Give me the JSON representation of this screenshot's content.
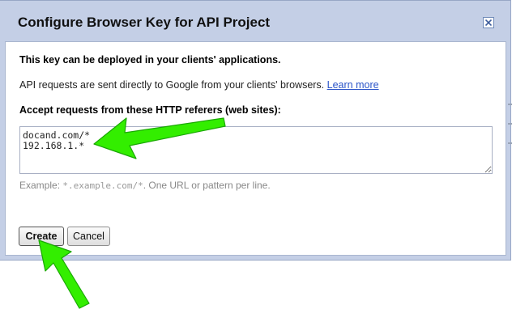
{
  "dialog": {
    "title": "Configure Browser Key for API Project",
    "lead": "This key can be deployed in your clients' applications.",
    "info_text": "API requests are sent directly to Google from your clients' browsers. ",
    "learn_more": "Learn more",
    "field_label": "Accept requests from these HTTP referers (web sites):",
    "referers_value": "docand.com/*\n192.168.1.*",
    "hint_prefix": "Example: ",
    "hint_example": "*.example.com/*",
    "hint_suffix": ". One URL or pattern per line.",
    "create_label": "Create",
    "cancel_label": "Cancel"
  },
  "icons": {
    "close": "close-icon",
    "arrow": "green-arrow-annotation"
  },
  "colors": {
    "header": "#c4cfe6",
    "link": "#2a54c8",
    "arrow": "#33ee00"
  }
}
